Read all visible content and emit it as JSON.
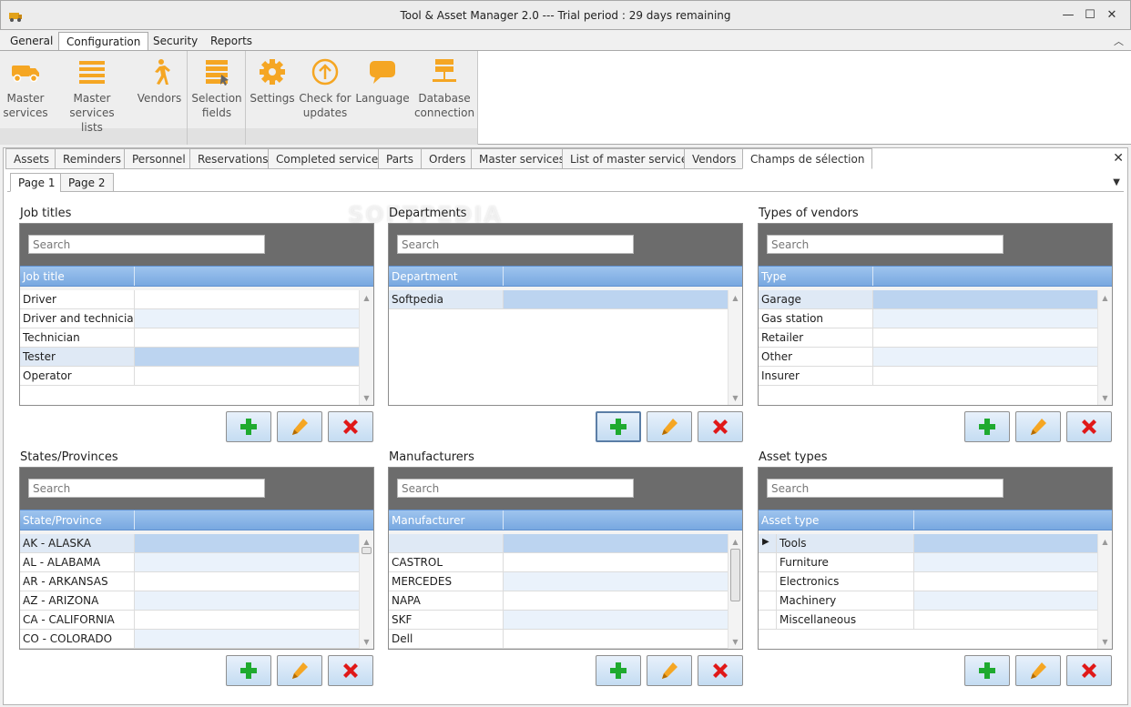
{
  "window": {
    "title": "Tool & Asset Manager 2.0 --- Trial period : 29 days remaining",
    "controls": {
      "minimize": "—",
      "maximize": "☐",
      "close": "✕"
    }
  },
  "menu": {
    "tabs": [
      "General",
      "Configuration",
      "Security",
      "Reports"
    ],
    "active": "Configuration",
    "collapse_glyph": "︿"
  },
  "ribbon": {
    "groups": [
      {
        "buttons": [
          {
            "label_line1": "Master",
            "label_line2": "services",
            "icon": "truck-icon"
          },
          {
            "label_line1": "Master services",
            "label_line2": "lists",
            "icon": "list-icon"
          },
          {
            "label_line1": "Vendors",
            "label_line2": "",
            "icon": "walking-person-icon"
          }
        ]
      },
      {
        "buttons": [
          {
            "label_line1": "Selection",
            "label_line2": "fields",
            "icon": "selection-fields-icon"
          }
        ]
      },
      {
        "buttons": [
          {
            "label_line1": "Settings",
            "label_line2": "",
            "icon": "gear-icon"
          },
          {
            "label_line1": "Check for",
            "label_line2": "updates",
            "icon": "arrow-up-circle-icon"
          },
          {
            "label_line1": "Language",
            "label_line2": "",
            "icon": "speech-bubble-icon"
          },
          {
            "label_line1": "Database",
            "label_line2": "connection",
            "icon": "database-icon"
          }
        ]
      }
    ],
    "icon_color": "#f5a623"
  },
  "doc_tabs": [
    "Assets",
    "Reminders",
    "Personnel",
    "Reservations",
    "Completed services",
    "Parts",
    "Orders",
    "Master services",
    "List of master services",
    "Vendors",
    "Champs de sélection"
  ],
  "doc_tab_active": "Champs de sélection",
  "page_tabs": [
    "Page 1",
    "Page 2"
  ],
  "page_tab_active": "Page 1",
  "watermark": "SOFTPEDIA",
  "panels": [
    {
      "title": "Job titles",
      "search_placeholder": "Search",
      "column": "Job title",
      "rows": [
        "Driver",
        "Driver and technician",
        "Technician",
        "Tester",
        "Operator"
      ],
      "selected_row": "Tester"
    },
    {
      "title": "Departments",
      "search_placeholder": "Search",
      "column": "Department",
      "rows": [
        "Softpedia"
      ],
      "selected_row": "Softpedia"
    },
    {
      "title": "Types of vendors",
      "search_placeholder": "Search",
      "column": "Type",
      "rows": [
        "Garage",
        "Gas station",
        "Retailer",
        "Other",
        "Insurer"
      ],
      "selected_row": "Garage"
    },
    {
      "title": "States/Provinces",
      "search_placeholder": "Search",
      "column": "State/Province",
      "rows": [
        "AK - ALASKA",
        "AL - ALABAMA",
        "AR - ARKANSAS",
        "AZ - ARIZONA",
        "CA - CALIFORNIA",
        "CO - COLORADO"
      ],
      "selected_row": "AK - ALASKA"
    },
    {
      "title": "Manufacturers",
      "search_placeholder": "Search",
      "column": "Manufacturer",
      "rows": [
        "",
        "CASTROL",
        "MERCEDES",
        "NAPA",
        "SKF",
        "Dell"
      ],
      "selected_row": ""
    },
    {
      "title": "Asset types",
      "search_placeholder": "Search",
      "column": "Asset type",
      "rows": [
        "Tools",
        "Furniture",
        "Electronics",
        "Machinery",
        "Miscellaneous"
      ],
      "selected_row": "Tools",
      "row_indicator": "▶"
    }
  ],
  "action_colors": {
    "add": "#1faa2f",
    "edit": "#f5a623",
    "delete": "#e01818"
  }
}
